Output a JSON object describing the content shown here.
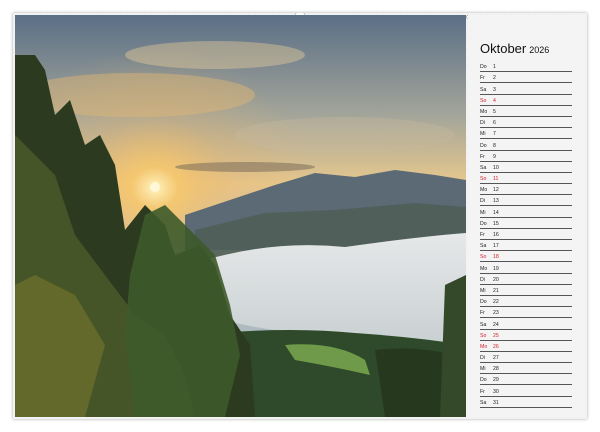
{
  "calendar": {
    "month": "Oktober",
    "year": "2026",
    "days": [
      {
        "wd": "Do",
        "n": "1",
        "sunday": false
      },
      {
        "wd": "Fr",
        "n": "2",
        "sunday": false
      },
      {
        "wd": "Sa",
        "n": "3",
        "sunday": false
      },
      {
        "wd": "So",
        "n": "4",
        "sunday": true
      },
      {
        "wd": "Mo",
        "n": "5",
        "sunday": false
      },
      {
        "wd": "Di",
        "n": "6",
        "sunday": false
      },
      {
        "wd": "Mi",
        "n": "7",
        "sunday": false
      },
      {
        "wd": "Do",
        "n": "8",
        "sunday": false
      },
      {
        "wd": "Fr",
        "n": "9",
        "sunday": false
      },
      {
        "wd": "Sa",
        "n": "10",
        "sunday": false
      },
      {
        "wd": "So",
        "n": "11",
        "sunday": true
      },
      {
        "wd": "Mo",
        "n": "12",
        "sunday": false
      },
      {
        "wd": "Di",
        "n": "13",
        "sunday": false
      },
      {
        "wd": "Mi",
        "n": "14",
        "sunday": false
      },
      {
        "wd": "Do",
        "n": "15",
        "sunday": false
      },
      {
        "wd": "Fr",
        "n": "16",
        "sunday": false
      },
      {
        "wd": "Sa",
        "n": "17",
        "sunday": false
      },
      {
        "wd": "So",
        "n": "18",
        "sunday": true
      },
      {
        "wd": "Mo",
        "n": "19",
        "sunday": false
      },
      {
        "wd": "Di",
        "n": "20",
        "sunday": false
      },
      {
        "wd": "Mi",
        "n": "21",
        "sunday": false
      },
      {
        "wd": "Do",
        "n": "22",
        "sunday": false
      },
      {
        "wd": "Fr",
        "n": "23",
        "sunday": false
      },
      {
        "wd": "Sa",
        "n": "24",
        "sunday": false
      },
      {
        "wd": "So",
        "n": "25",
        "sunday": true
      },
      {
        "wd": "Mo",
        "n": "26",
        "sunday": true
      },
      {
        "wd": "Di",
        "n": "27",
        "sunday": false
      },
      {
        "wd": "Mi",
        "n": "28",
        "sunday": false
      },
      {
        "wd": "Do",
        "n": "29",
        "sunday": false
      },
      {
        "wd": "Fr",
        "n": "30",
        "sunday": false
      },
      {
        "wd": "Sa",
        "n": "31",
        "sunday": false
      }
    ]
  },
  "colors": {
    "holiday": "#d0202a",
    "text": "#222222"
  },
  "photo": {
    "icon": "mountain-sunrise-photo"
  }
}
